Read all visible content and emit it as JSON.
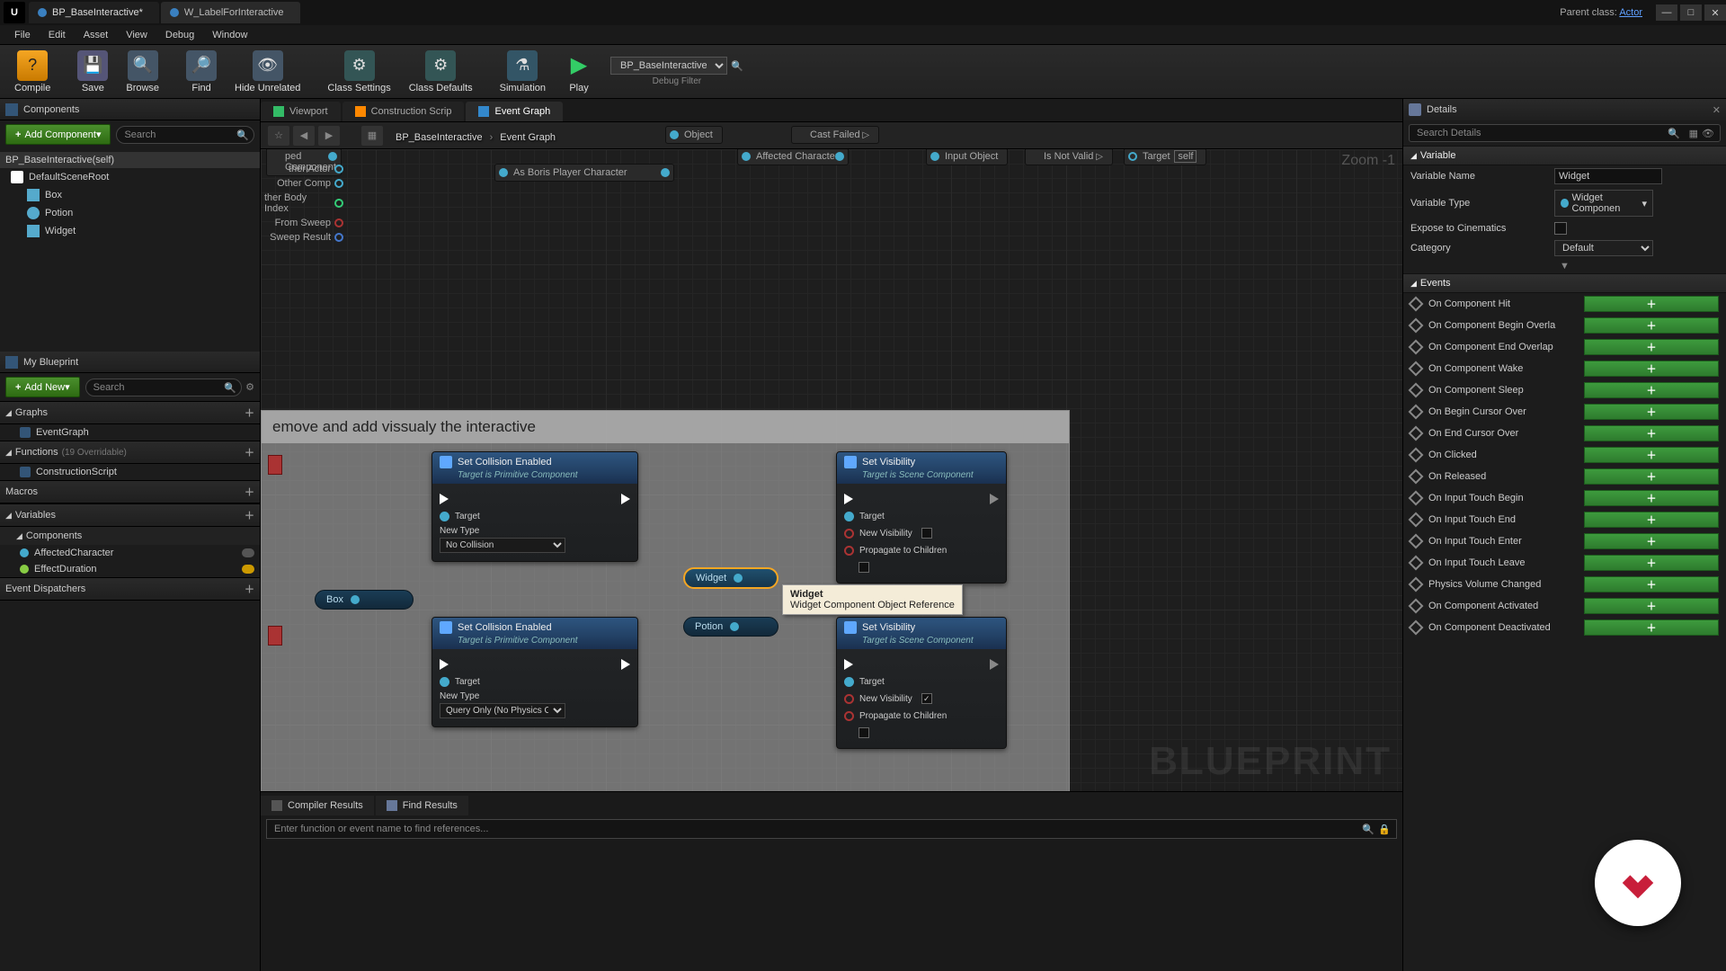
{
  "titlebar": {
    "tabs": [
      {
        "label": "BP_BaseInteractive*",
        "active": true
      },
      {
        "label": "W_LabelForInteractive",
        "active": false
      }
    ],
    "parent_prefix": "Parent class:",
    "parent_class": "Actor"
  },
  "menu": [
    "File",
    "Edit",
    "Asset",
    "View",
    "Debug",
    "Window"
  ],
  "toolbar": {
    "compile": "Compile",
    "save": "Save",
    "browse": "Browse",
    "find": "Find",
    "hide": "Hide Unrelated",
    "class_settings": "Class Settings",
    "class_defaults": "Class Defaults",
    "simulation": "Simulation",
    "play": "Play",
    "debug_combo": "BP_BaseInteractive",
    "debug_label": "Debug Filter"
  },
  "components": {
    "panel": "Components",
    "add": "Add Component",
    "search": "Search",
    "root": "BP_BaseInteractive(self)",
    "items": [
      "DefaultSceneRoot",
      "Box",
      "Potion",
      "Widget"
    ]
  },
  "myblueprint": {
    "panel": "My Blueprint",
    "add": "Add New",
    "search": "Search",
    "graphs": "Graphs",
    "eventgraph": "EventGraph",
    "functions": "Functions",
    "functions_ann": "(19 Overridable)",
    "construction": "ConstructionScript",
    "macros": "Macros",
    "variables": "Variables",
    "components": "Components",
    "vars": [
      {
        "name": "AffectedCharacter",
        "color": "#4ac",
        "eye": false
      },
      {
        "name": "EffectDuration",
        "color": "#8c4",
        "eye": true
      }
    ],
    "dispatchers": "Event Dispatchers"
  },
  "graph": {
    "tabs": [
      {
        "label": "Viewport",
        "icon": "vp"
      },
      {
        "label": "Construction Scrip",
        "icon": "cs"
      },
      {
        "label": "Event Graph",
        "icon": "eg",
        "active": true
      }
    ],
    "bc_root": "BP_BaseInteractive",
    "bc_leaf": "Event Graph",
    "zoom": "Zoom -1",
    "watermark": "BLUEPRINT",
    "top_nodes": {
      "overlapped": "ped Component",
      "object": "Object",
      "cast_failed": "Cast Failed",
      "boris": "As Boris Player Character",
      "affected": "Affected Character",
      "input_obj": "Input Object",
      "not_valid": "Is Not Valid",
      "target": "Target",
      "self": "self"
    },
    "side_pins": [
      "ther Actor",
      "Other Comp",
      "ther Body Index",
      "From Sweep",
      "Sweep Result"
    ],
    "comment": "emove and add vissualy the interactive",
    "node_sce": {
      "title": "Set Collision Enabled",
      "sub": "Target is Primitive Component",
      "target": "Target",
      "newtype": "New Type",
      "opt_no": "No Collision"
    },
    "node_sce2": {
      "title": "Set Collision Enabled",
      "sub": "Target is Primitive Component",
      "target": "Target",
      "newtype": "New Type",
      "opt_q": "Query Only (No Physics Collision)"
    },
    "node_sv": {
      "title": "Set Visibility",
      "sub": "Target is Scene Component",
      "target": "Target",
      "newvis": "New Visibility",
      "prop": "Propagate to Children"
    },
    "varnodes": {
      "box": "Box",
      "widget": "Widget",
      "potion": "Potion"
    },
    "tooltip": {
      "title": "Widget",
      "body": "Widget Component Object Reference"
    }
  },
  "compiler": {
    "results": "Compiler Results",
    "find": "Find Results",
    "placeholder": "Enter function or event name to find references..."
  },
  "details": {
    "panel": "Details",
    "search": "Search Details",
    "cat_var": "Variable",
    "rows": {
      "name_k": "Variable Name",
      "name_v": "Widget",
      "type_k": "Variable Type",
      "type_v": "Widget Componen",
      "expose_k": "Expose to Cinematics",
      "category_k": "Category",
      "category_v": "Default"
    },
    "cat_events": "Events",
    "events": [
      "On Component Hit",
      "On Component Begin Overla",
      "On Component End Overlap",
      "On Component Wake",
      "On Component Sleep",
      "On Begin Cursor Over",
      "On End Cursor Over",
      "On Clicked",
      "On Released",
      "On Input Touch Begin",
      "On Input Touch End",
      "On Input Touch Enter",
      "On Input Touch Leave",
      "Physics Volume Changed",
      "On Component Activated",
      "On Component Deactivated"
    ]
  }
}
